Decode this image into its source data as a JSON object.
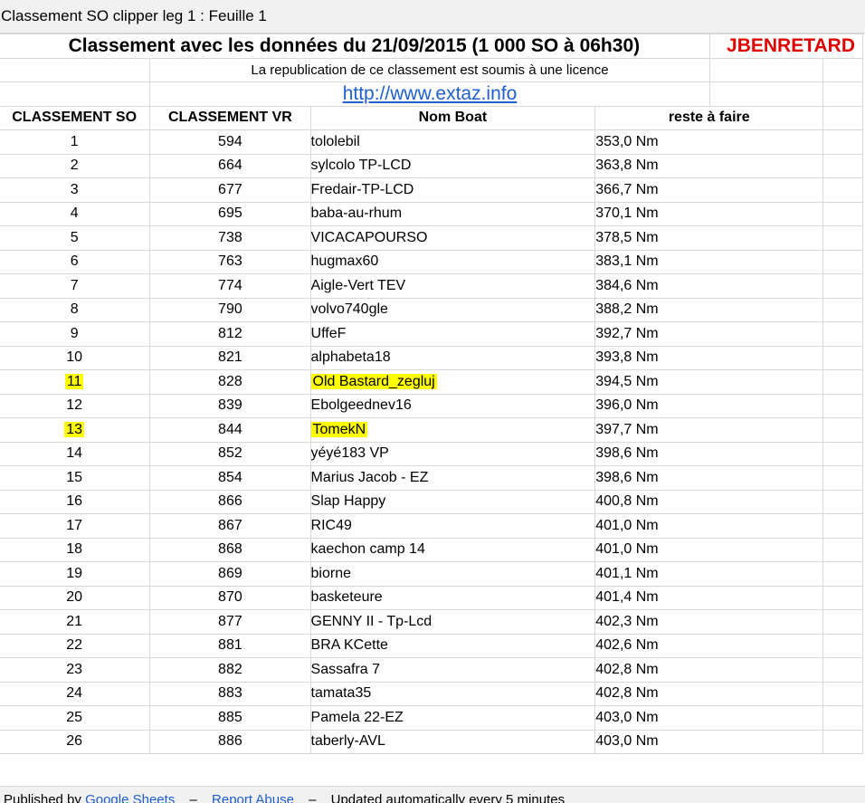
{
  "window": {
    "title": "Classement SO clipper leg 1 : Feuille 1"
  },
  "sheet": {
    "title": "Classement avec les données du 21/09/2015 (1 000 SO à 06h30)",
    "brand": "JBENRETARD",
    "licence_note": "La republication de ce classement est soumis à une licence",
    "link_text": "http://www.extaz.info",
    "headers": [
      "CLASSEMENT SO",
      "CLASSEMENT VR",
      "Nom Boat",
      "reste à faire"
    ],
    "rows": [
      {
        "so": "1",
        "vr": "594",
        "name": "tololebil",
        "rest": "353,0 Nm",
        "highlight": false
      },
      {
        "so": "2",
        "vr": "664",
        "name": "sylcolo TP-LCD",
        "rest": "363,8 Nm",
        "highlight": false
      },
      {
        "so": "3",
        "vr": "677",
        "name": "Fredair-TP-LCD",
        "rest": "366,7 Nm",
        "highlight": false
      },
      {
        "so": "4",
        "vr": "695",
        "name": "baba-au-rhum",
        "rest": "370,1 Nm",
        "highlight": false
      },
      {
        "so": "5",
        "vr": "738",
        "name": "VICACAPOURSO",
        "rest": "378,5 Nm",
        "highlight": false
      },
      {
        "so": "6",
        "vr": "763",
        "name": "hugmax60",
        "rest": "383,1 Nm",
        "highlight": false
      },
      {
        "so": "7",
        "vr": "774",
        "name": "Aigle-Vert TEV",
        "rest": "384,6 Nm",
        "highlight": false
      },
      {
        "so": "8",
        "vr": "790",
        "name": "volvo740gle",
        "rest": "388,2 Nm",
        "highlight": false
      },
      {
        "so": "9",
        "vr": "812",
        "name": "UffeF",
        "rest": "392,7 Nm",
        "highlight": false
      },
      {
        "so": "10",
        "vr": "821",
        "name": "alphabeta18",
        "rest": "393,8 Nm",
        "highlight": false
      },
      {
        "so": "11",
        "vr": "828",
        "name": "Old Bastard_zegluj",
        "rest": "394,5 Nm",
        "highlight": true
      },
      {
        "so": "12",
        "vr": "839",
        "name": "Ebolgeednev16",
        "rest": "396,0 Nm",
        "highlight": false
      },
      {
        "so": "13",
        "vr": "844",
        "name": "TomekN",
        "rest": "397,7 Nm",
        "highlight": true
      },
      {
        "so": "14",
        "vr": "852",
        "name": "yéyé183 VP",
        "rest": "398,6 Nm",
        "highlight": false
      },
      {
        "so": "15",
        "vr": "854",
        "name": "Marius Jacob - EZ",
        "rest": "398,6 Nm",
        "highlight": false
      },
      {
        "so": "16",
        "vr": "866",
        "name": "Slap Happy",
        "rest": "400,8 Nm",
        "highlight": false
      },
      {
        "so": "17",
        "vr": "867",
        "name": "RIC49",
        "rest": "401,0 Nm",
        "highlight": false
      },
      {
        "so": "18",
        "vr": "868",
        "name": "kaechon camp 14",
        "rest": "401,0 Nm",
        "highlight": false
      },
      {
        "so": "19",
        "vr": "869",
        "name": "biorne",
        "rest": "401,1 Nm",
        "highlight": false
      },
      {
        "so": "20",
        "vr": "870",
        "name": "basketeure",
        "rest": "401,4 Nm",
        "highlight": false
      },
      {
        "so": "21",
        "vr": "877",
        "name": "GENNY II - Tp-Lcd",
        "rest": "402,3 Nm",
        "highlight": false
      },
      {
        "so": "22",
        "vr": "881",
        "name": "BRA KCette",
        "rest": "402,6 Nm",
        "highlight": false
      },
      {
        "so": "23",
        "vr": "882",
        "name": "Sassafra 7",
        "rest": "402,8 Nm",
        "highlight": false
      },
      {
        "so": "24",
        "vr": "883",
        "name": "tamata35",
        "rest": "402,8 Nm",
        "highlight": false
      },
      {
        "so": "25",
        "vr": "885",
        "name": "Pamela 22-EZ",
        "rest": "403,0 Nm",
        "highlight": false
      },
      {
        "so": "26",
        "vr": "886",
        "name": "taberly-AVL",
        "rest": "403,0 Nm",
        "highlight": false
      }
    ]
  },
  "footer": {
    "published_by": "Published by",
    "google_sheets": "Google Sheets",
    "separator": "–",
    "report_abuse": "Report Abuse",
    "updated": "Updated automatically every 5 minutes"
  },
  "colors": {
    "highlight": "#ffff00",
    "brand": "#e00000",
    "link": "#1f5fcf"
  }
}
